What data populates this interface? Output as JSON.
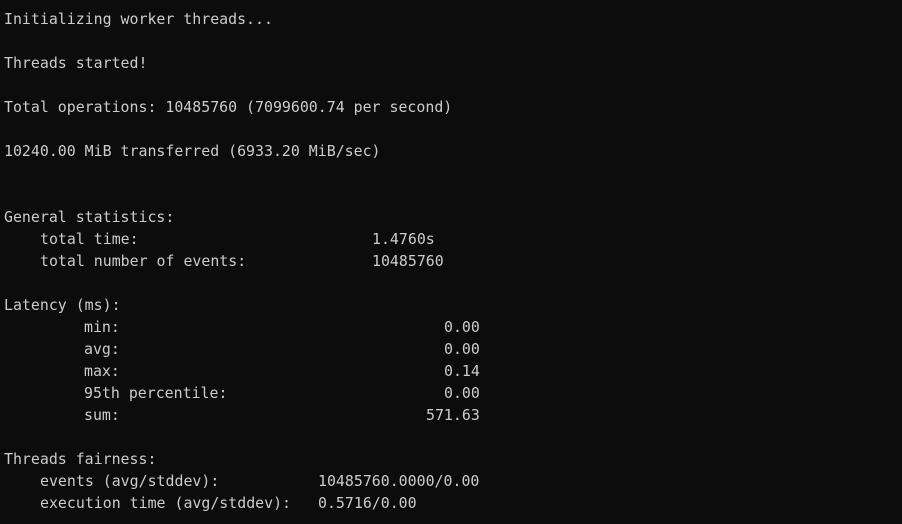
{
  "terminal": {
    "init_line": "Initializing worker threads...",
    "started_line": "Threads started!",
    "total_ops_line": "Total operations: 10485760 (7099600.74 per second)",
    "transferred_line": "10240.00 MiB transferred (6933.20 MiB/sec)",
    "general": {
      "header": "General statistics:",
      "total_time_label": "total time:",
      "total_time_value": "1.4760s",
      "total_events_label": "total number of events:",
      "total_events_value": "10485760"
    },
    "latency": {
      "header": "Latency (ms):",
      "min_label": "min:",
      "min_value": "0.00",
      "avg_label": "avg:",
      "avg_value": "0.00",
      "max_label": "max:",
      "max_value": "0.14",
      "p95_label": "95th percentile:",
      "p95_value": "0.00",
      "sum_label": "sum:",
      "sum_value": "571.63"
    },
    "fairness": {
      "header": "Threads fairness:",
      "events_label": "events (avg/stddev):",
      "events_value": "10485760.0000/0.00",
      "exec_label": "execution time (avg/stddev):",
      "exec_value": "0.5716/0.00"
    }
  }
}
